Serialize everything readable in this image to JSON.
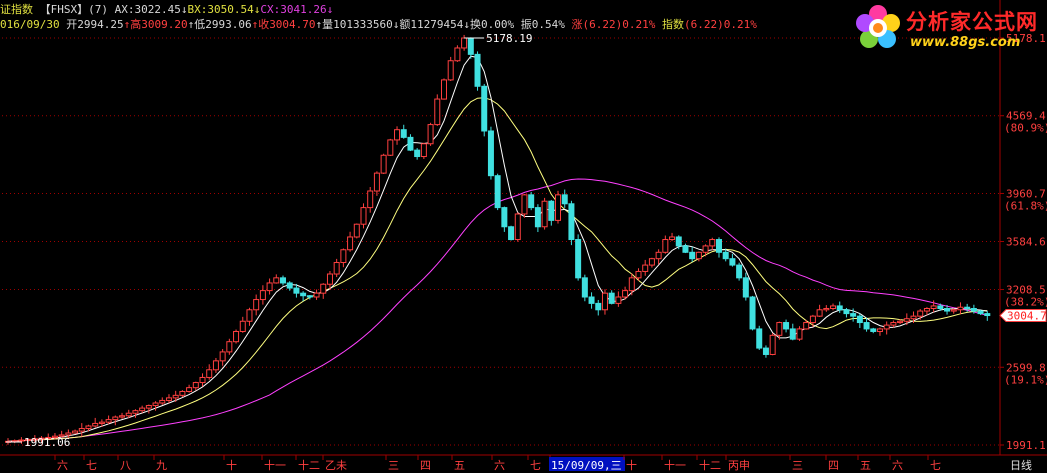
{
  "header": {
    "title": "证指数",
    "code": "【FHSX】",
    "period": "(7)",
    "ax_label": "AX:",
    "ax_value": "3022.45",
    "bx_label": "BX:",
    "bx_value": "3050.54",
    "cx_label": "CX:",
    "cx_value": "3041.26",
    "arrow_down": "↓",
    "arrow_up": "↑",
    "date": "016/09/30",
    "open_label": "开",
    "open_value": "2994.25",
    "high_label": "高",
    "high_value": "3009.20",
    "low_label": "低",
    "low_value": "2993.06",
    "close_label": "收",
    "close_value": "3004.70",
    "volume_label": "量",
    "volume_value": "101333560",
    "amount_label": "额",
    "amount_value": "11279454",
    "turnover_label": "换",
    "turnover_value": "0.00%",
    "amplitude_label": "振",
    "amplitude_value": "0.54%",
    "change_label": "涨",
    "change_value": "(6.22)",
    "change_pct": "0.21%",
    "index_label": "指数",
    "index_value": "(6.22)",
    "index_pct": "0.21%"
  },
  "logo": {
    "title": "分析家公式网",
    "url": "www.88gs.com"
  },
  "right_axis": [
    {
      "price": "5178.1",
      "pct": ""
    },
    {
      "price": "4569.4",
      "pct": "(80.9%)"
    },
    {
      "price": "3960.7",
      "pct": "(61.8%)"
    },
    {
      "price": "3584.6",
      "pct": ""
    },
    {
      "price": "3208.5",
      "pct": "(38.2%)"
    },
    {
      "price": "2599.8",
      "pct": "(19.1%)"
    },
    {
      "price": "1991.1",
      "pct": ""
    }
  ],
  "current_price_tag": "3004.7",
  "annotations": {
    "high": "5178.19",
    "low": "1991.06"
  },
  "bottom_axis": [
    "六",
    "七",
    "八",
    "九",
    "十",
    "十一",
    "十二",
    "乙未",
    "三",
    "四",
    "五",
    "六",
    "七",
    "15/09/09,三",
    "十",
    "十一",
    "十二",
    "丙申",
    "三",
    "四",
    "五",
    "六",
    "七"
  ],
  "bottom_right_tab": "日线",
  "colors": {
    "up": "#ff4040",
    "down": "#40e0e0",
    "ma_short": "#ffffff",
    "ma_mid": "#ffff80",
    "ma_long": "#ff40ff",
    "grid": "#a00000",
    "axis_text": "#ff4040"
  },
  "chart_data": {
    "type": "candlestick",
    "y_min": 1991.1,
    "y_max": 5178.1,
    "closes": [
      2020,
      2025,
      2030,
      2035,
      2040,
      2045,
      2050,
      2060,
      2070,
      2085,
      2100,
      2120,
      2140,
      2160,
      2170,
      2190,
      2210,
      2220,
      2240,
      2260,
      2280,
      2300,
      2320,
      2340,
      2360,
      2380,
      2410,
      2440,
      2480,
      2520,
      2580,
      2650,
      2720,
      2800,
      2880,
      2960,
      3050,
      3130,
      3200,
      3260,
      3300,
      3260,
      3220,
      3180,
      3160,
      3150,
      3180,
      3250,
      3330,
      3420,
      3520,
      3620,
      3720,
      3850,
      3980,
      4120,
      4260,
      4380,
      4460,
      4400,
      4300,
      4250,
      4350,
      4500,
      4700,
      4850,
      5000,
      5100,
      5178,
      5050,
      4800,
      4450,
      4100,
      3850,
      3700,
      3600,
      3800,
      3950,
      3850,
      3700,
      3900,
      3750,
      3950,
      3880,
      3600,
      3300,
      3150,
      3100,
      3050,
      3180,
      3100,
      3150,
      3200,
      3300,
      3350,
      3400,
      3450,
      3500,
      3600,
      3620,
      3550,
      3500,
      3450,
      3500,
      3550,
      3600,
      3500,
      3450,
      3400,
      3300,
      3150,
      2900,
      2750,
      2700,
      2850,
      2950,
      2900,
      2820,
      2900,
      2950,
      3000,
      3050,
      3060,
      3080,
      3050,
      3020,
      3000,
      2950,
      2900,
      2880,
      2900,
      2930,
      2950,
      2960,
      2980,
      3000,
      3040,
      3060,
      3080,
      3060,
      3040,
      3050,
      3070,
      3060,
      3040,
      3020,
      3005
    ],
    "labels": {
      "high": "5178.19",
      "low": "1991.06"
    }
  }
}
